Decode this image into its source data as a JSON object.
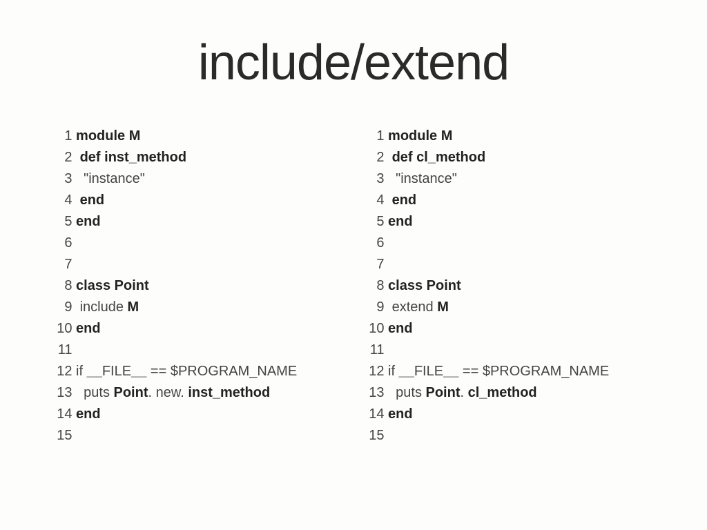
{
  "title": "include/extend",
  "left": {
    "lines": [
      {
        "n": "1",
        "segs": [
          {
            "t": " ",
            "b": false
          },
          {
            "t": "module",
            "b": true
          },
          {
            "t": " ",
            "b": false
          },
          {
            "t": "M",
            "b": true
          }
        ]
      },
      {
        "n": "2",
        "segs": [
          {
            "t": "  ",
            "b": false
          },
          {
            "t": "def",
            "b": true
          },
          {
            "t": " ",
            "b": false
          },
          {
            "t": "inst_method",
            "b": true
          }
        ]
      },
      {
        "n": "3",
        "segs": [
          {
            "t": "   \"instance\"",
            "b": false
          }
        ]
      },
      {
        "n": "4",
        "segs": [
          {
            "t": "  ",
            "b": false
          },
          {
            "t": "end",
            "b": true
          }
        ]
      },
      {
        "n": "5",
        "segs": [
          {
            "t": " ",
            "b": false
          },
          {
            "t": "end",
            "b": true
          }
        ]
      },
      {
        "n": "6",
        "segs": [
          {
            "t": " ",
            "b": false
          }
        ]
      },
      {
        "n": "7",
        "segs": [
          {
            "t": " ",
            "b": false
          }
        ]
      },
      {
        "n": "8",
        "segs": [
          {
            "t": " ",
            "b": false
          },
          {
            "t": "class",
            "b": true
          },
          {
            "t": " ",
            "b": false
          },
          {
            "t": "Point",
            "b": true
          }
        ]
      },
      {
        "n": "9",
        "segs": [
          {
            "t": "  include ",
            "b": false
          },
          {
            "t": "M",
            "b": true
          }
        ]
      },
      {
        "n": "10",
        "segs": [
          {
            "t": " ",
            "b": false
          },
          {
            "t": "end",
            "b": true
          }
        ]
      },
      {
        "n": "11",
        "segs": [
          {
            "t": " ",
            "b": false
          }
        ]
      },
      {
        "n": "12",
        "segs": [
          {
            "t": " if ",
            "b": false
          },
          {
            "t": "__",
            "b": true
          },
          {
            "t": "FILE",
            "b": false
          },
          {
            "t": "__",
            "b": true
          },
          {
            "t": " == $PROGRAM_NAME",
            "b": false
          }
        ]
      },
      {
        "n": "13",
        "segs": [
          {
            "t": "   puts ",
            "b": false
          },
          {
            "t": "Point",
            "b": true
          },
          {
            "t": ". new. ",
            "b": false
          },
          {
            "t": "inst_method",
            "b": true
          }
        ]
      },
      {
        "n": "14",
        "segs": [
          {
            "t": " ",
            "b": false
          },
          {
            "t": "end",
            "b": true
          }
        ]
      },
      {
        "n": "15",
        "segs": [
          {
            "t": " ",
            "b": false
          }
        ]
      }
    ]
  },
  "right": {
    "lines": [
      {
        "n": "1",
        "segs": [
          {
            "t": " ",
            "b": false
          },
          {
            "t": "module",
            "b": true
          },
          {
            "t": " ",
            "b": false
          },
          {
            "t": "M",
            "b": true
          }
        ]
      },
      {
        "n": "2",
        "segs": [
          {
            "t": "  ",
            "b": false
          },
          {
            "t": "def",
            "b": true
          },
          {
            "t": " ",
            "b": false
          },
          {
            "t": "cl_method",
            "b": true
          }
        ]
      },
      {
        "n": "3",
        "segs": [
          {
            "t": "   \"instance\"",
            "b": false
          }
        ]
      },
      {
        "n": "4",
        "segs": [
          {
            "t": "  ",
            "b": false
          },
          {
            "t": "end",
            "b": true
          }
        ]
      },
      {
        "n": "5",
        "segs": [
          {
            "t": " ",
            "b": false
          },
          {
            "t": "end",
            "b": true
          }
        ]
      },
      {
        "n": "6",
        "segs": [
          {
            "t": " ",
            "b": false
          }
        ]
      },
      {
        "n": "7",
        "segs": [
          {
            "t": " ",
            "b": false
          }
        ]
      },
      {
        "n": "8",
        "segs": [
          {
            "t": " ",
            "b": false
          },
          {
            "t": "class",
            "b": true
          },
          {
            "t": " ",
            "b": false
          },
          {
            "t": "Point",
            "b": true
          }
        ]
      },
      {
        "n": "9",
        "segs": [
          {
            "t": "  extend ",
            "b": false
          },
          {
            "t": "M",
            "b": true
          }
        ]
      },
      {
        "n": "10",
        "segs": [
          {
            "t": " ",
            "b": false
          },
          {
            "t": "end",
            "b": true
          }
        ]
      },
      {
        "n": "11",
        "segs": [
          {
            "t": " ",
            "b": false
          }
        ]
      },
      {
        "n": "12",
        "segs": [
          {
            "t": " if ",
            "b": false
          },
          {
            "t": "__",
            "b": true
          },
          {
            "t": "FILE",
            "b": false
          },
          {
            "t": "__",
            "b": true
          },
          {
            "t": " == $PROGRAM_NAME",
            "b": false
          }
        ]
      },
      {
        "n": "13",
        "segs": [
          {
            "t": "   puts ",
            "b": false
          },
          {
            "t": "Point",
            "b": true
          },
          {
            "t": ". ",
            "b": false
          },
          {
            "t": "cl_method",
            "b": true
          }
        ]
      },
      {
        "n": "14",
        "segs": [
          {
            "t": " ",
            "b": false
          },
          {
            "t": "end",
            "b": true
          }
        ]
      },
      {
        "n": "15",
        "segs": [
          {
            "t": " ",
            "b": false
          }
        ]
      }
    ]
  }
}
